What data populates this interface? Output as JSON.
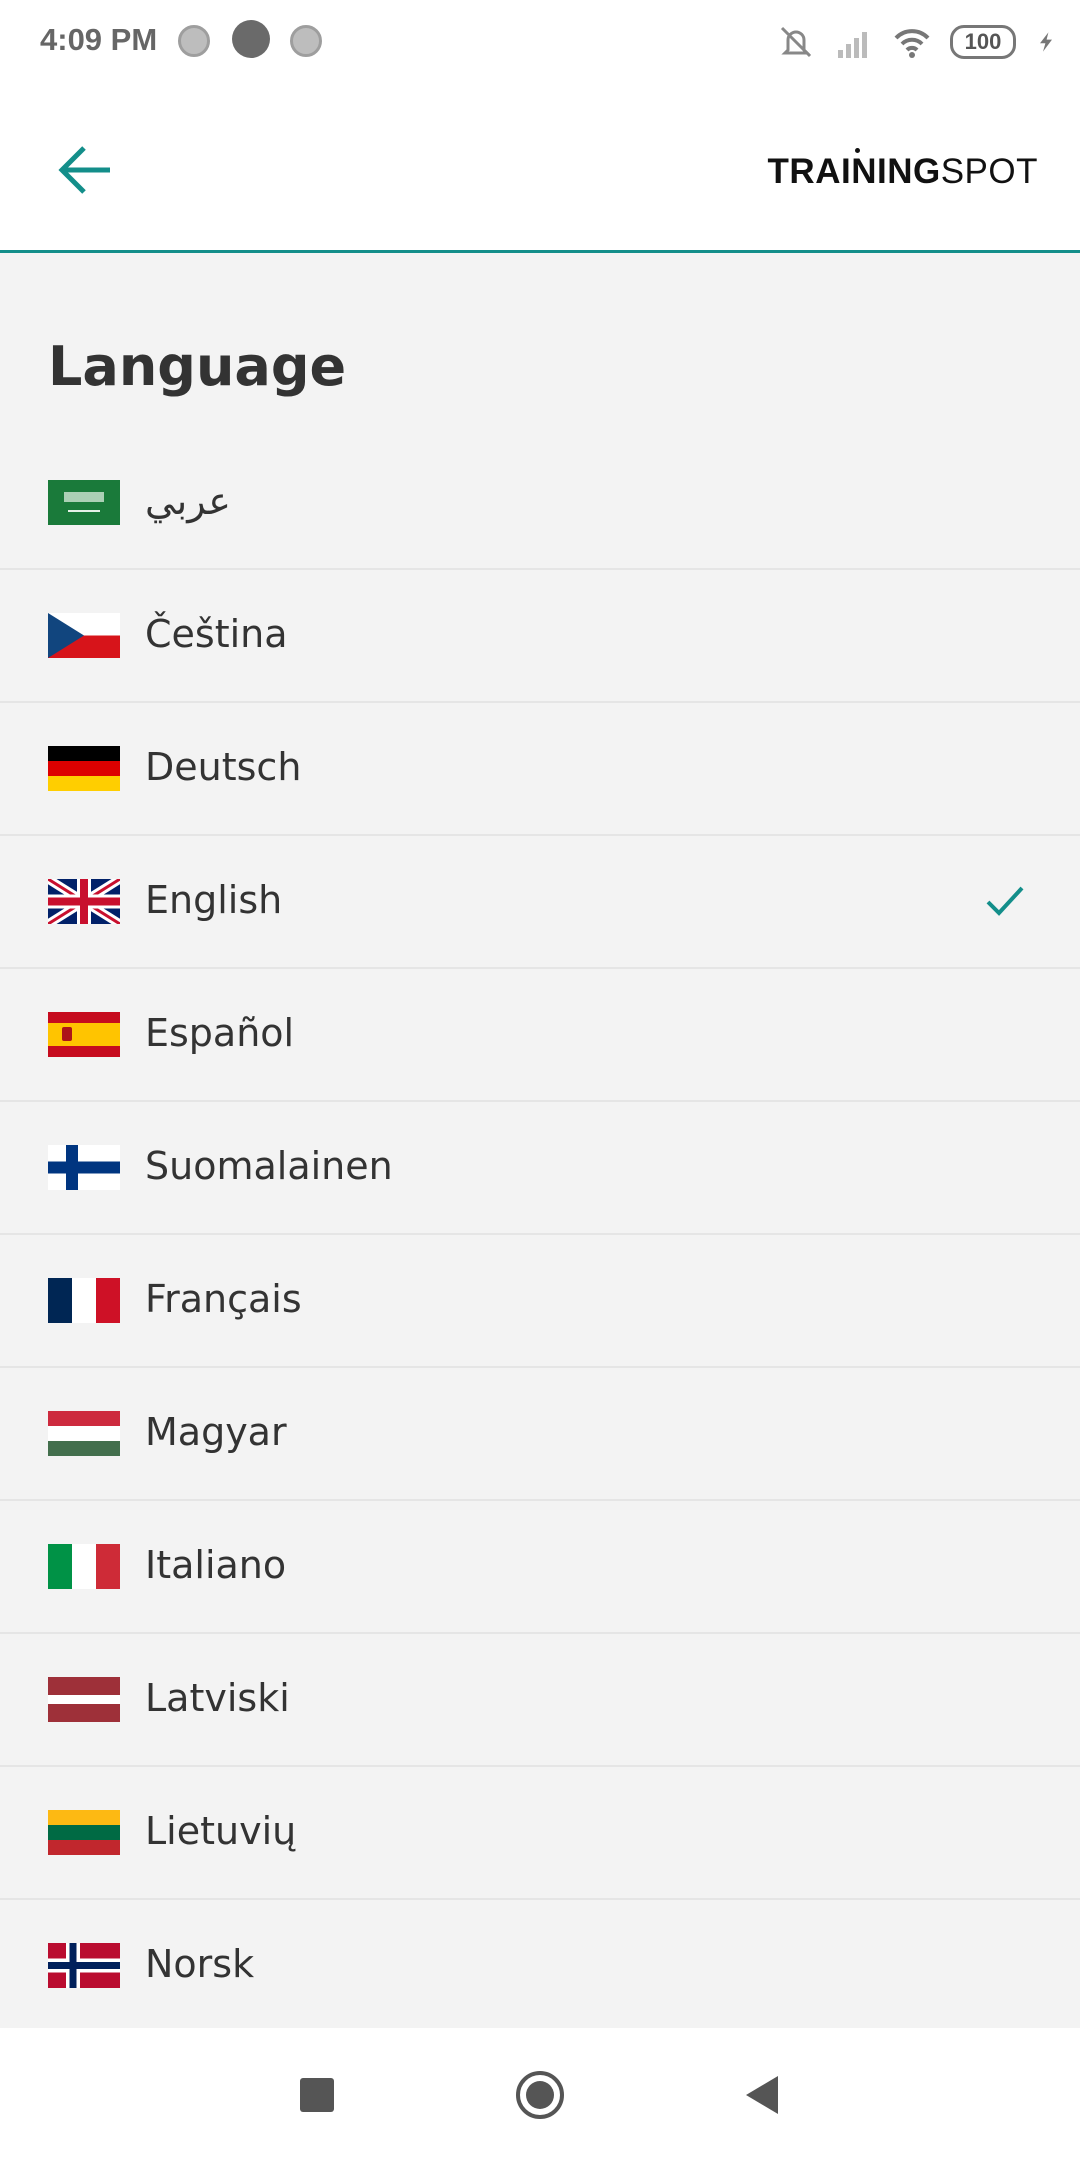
{
  "status_bar": {
    "time": "4:09 PM",
    "battery": "100",
    "icons": [
      "media-icon",
      "browser-icon",
      "media-icon",
      "mute-icon",
      "signal-icon",
      "wifi-icon",
      "battery-icon",
      "charging-icon"
    ]
  },
  "header": {
    "back_icon": "arrow-left-icon",
    "logo_text": "TRAININGSPOT",
    "logo_part1": "TRAINING",
    "logo_part2": "SPOT"
  },
  "page": {
    "title": "Language"
  },
  "languages": [
    {
      "label": "عربي",
      "flag": "saudi-arabia-flag",
      "selected": false
    },
    {
      "label": "Čeština",
      "flag": "czech-flag",
      "selected": false
    },
    {
      "label": "Deutsch",
      "flag": "germany-flag",
      "selected": false
    },
    {
      "label": "English",
      "flag": "uk-flag",
      "selected": true
    },
    {
      "label": "Español",
      "flag": "spain-flag",
      "selected": false
    },
    {
      "label": "Suomalainen",
      "flag": "finland-flag",
      "selected": false
    },
    {
      "label": "Français",
      "flag": "france-flag",
      "selected": false
    },
    {
      "label": "Magyar",
      "flag": "hungary-flag",
      "selected": false
    },
    {
      "label": "Italiano",
      "flag": "italy-flag",
      "selected": false
    },
    {
      "label": "Latviski",
      "flag": "latvia-flag",
      "selected": false
    },
    {
      "label": "Lietuvių",
      "flag": "lithuania-flag",
      "selected": false
    },
    {
      "label": "Norsk",
      "flag": "norway-flag",
      "selected": false
    }
  ],
  "colors": {
    "accent": "#138e8a",
    "background": "#f3f3f3",
    "text": "#333333"
  },
  "nav_bar": {
    "icons": [
      "recents-icon",
      "home-icon",
      "back-icon"
    ]
  }
}
